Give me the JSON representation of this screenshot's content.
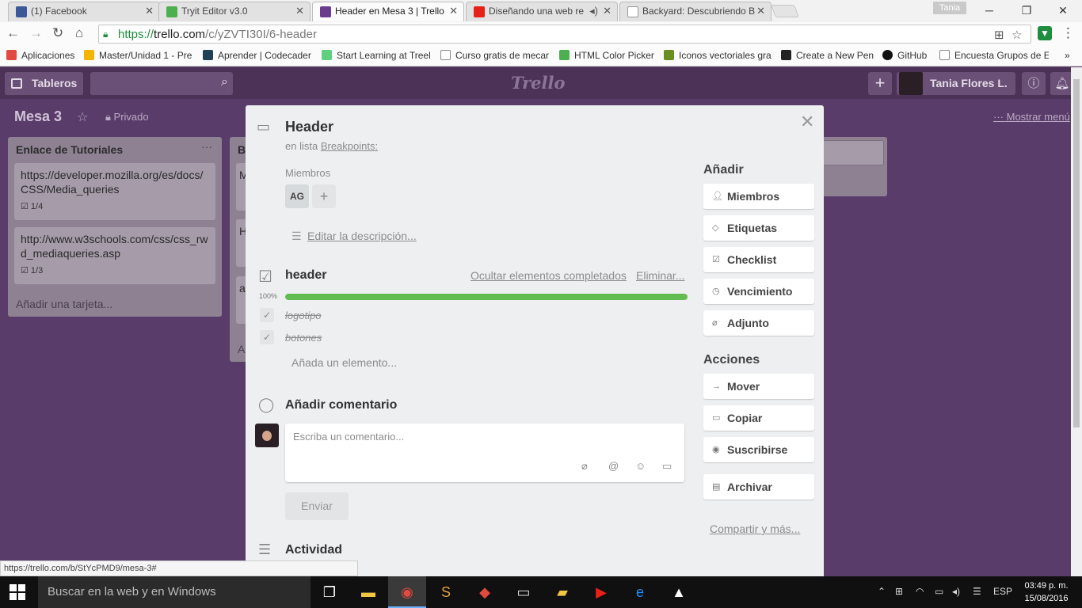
{
  "browser": {
    "tabs": [
      {
        "title": "(1) Facebook",
        "color": "#3b5998",
        "icon": "facebook-icon"
      },
      {
        "title": "Tryit Editor v3.0",
        "color": "#4caf50",
        "icon": "w3-icon"
      },
      {
        "title": "Header en Mesa 3 | Trello",
        "color": "#6a3c8e",
        "icon": "trello-icon"
      },
      {
        "title": "Diseñando una web re",
        "color": "#e62117",
        "icon": "youtube-icon"
      },
      {
        "title": "Backyard: Descubriendo B",
        "color": "#999999",
        "icon": "page-icon"
      }
    ],
    "user_chip": "Tania",
    "url_scheme": "https://",
    "url_host": "trello.com",
    "url_path": "/c/yZVTI30I/6-header",
    "bookmarks": [
      {
        "label": "Aplicaciones",
        "color": "#e04a3f",
        "icon": "apps-grid-icon"
      },
      {
        "label": "Master/Unidad 1 - Pre",
        "color": "#f4b400",
        "icon": "folder-icon"
      },
      {
        "label": "Aprender | Codecader",
        "color": "#1f4056",
        "icon": "codecademy-icon"
      },
      {
        "label": "Start Learning at Treel",
        "color": "#5fcf80",
        "icon": "treehouse-icon"
      },
      {
        "label": "Curso gratis de mecar",
        "color": "#888888",
        "icon": "page-icon"
      },
      {
        "label": "HTML Color Picker",
        "color": "#4caf50",
        "icon": "w3-icon"
      },
      {
        "label": "Iconos vectoriales gra",
        "color": "#6b8e23",
        "icon": "freepik-icon"
      },
      {
        "label": "Create a New Pen",
        "color": "#222222",
        "icon": "codepen-icon"
      },
      {
        "label": "GitHub",
        "color": "#111111",
        "icon": "github-icon"
      },
      {
        "label": "Encuesta Grupos de E",
        "color": "#888888",
        "icon": "page-icon"
      }
    ],
    "status_url": "https://trello.com/b/StYcPMD9/mesa-3#"
  },
  "trello": {
    "boards_label": "Tableros",
    "logo": "Trello",
    "user_name": "Tania Flores L.",
    "board_title": "Mesa 3",
    "privacy": "Privado",
    "show_menu": "Mostrar menú",
    "lists": [
      {
        "title": "Enlace de Tutoriales",
        "cards": [
          {
            "text": "https://developer.mozilla.org/es/docs/CSS/Media_queries",
            "badge": "1/4"
          },
          {
            "text": "http://www.w3schools.com/css/css_rwd_mediaqueries.asp",
            "badge": "1/3"
          }
        ],
        "add_card": "Añadir una tarjeta..."
      },
      {
        "title": "B",
        "peek": [
          "M",
          "H",
          "a"
        ],
        "add_card": "A"
      }
    ]
  },
  "modal": {
    "title": "Header",
    "in_list_prefix": "en lista",
    "in_list_name": "Breakpoints:",
    "members_label": "Miembros",
    "member_initials": "AG",
    "add_member": "+",
    "edit_description": "Editar la descripción...",
    "checklist": {
      "title": "header",
      "hide_completed": "Ocultar elementos completados",
      "delete": "Eliminar...",
      "percent_label": "100%",
      "percent": 100,
      "items": [
        {
          "text": "logotipo",
          "done": true
        },
        {
          "text": "botones",
          "done": true
        }
      ],
      "add_item": "Añada un elemento..."
    },
    "comment": {
      "title": "Añadir comentario",
      "placeholder": "Escriba un comentario...",
      "send": "Enviar"
    },
    "activity_title": "Actividad",
    "sidebar": {
      "add_heading": "Añadir",
      "add_buttons": [
        {
          "label": "Miembros",
          "icon": "person-icon"
        },
        {
          "label": "Etiquetas",
          "icon": "tag-icon"
        },
        {
          "label": "Checklist",
          "icon": "checkbox-icon"
        },
        {
          "label": "Vencimiento",
          "icon": "clock-icon"
        },
        {
          "label": "Adjunto",
          "icon": "paperclip-icon"
        }
      ],
      "actions_heading": "Acciones",
      "action_buttons": [
        {
          "label": "Mover",
          "icon": "arrow-right-icon"
        },
        {
          "label": "Copiar",
          "icon": "card-icon"
        },
        {
          "label": "Suscribirse",
          "icon": "eye-icon"
        },
        {
          "label": "Archivar",
          "icon": "archive-icon"
        }
      ],
      "share": "Compartir y más..."
    }
  },
  "taskbar": {
    "search_placeholder": "Buscar en la web y en Windows",
    "language": "ESP",
    "time": "03:49 p. m.",
    "date": "15/08/2016"
  },
  "colors": {
    "board_bg": "#5a3c6b",
    "progress_fill": "#61bd4f",
    "url_green": "#1e8e3e"
  }
}
